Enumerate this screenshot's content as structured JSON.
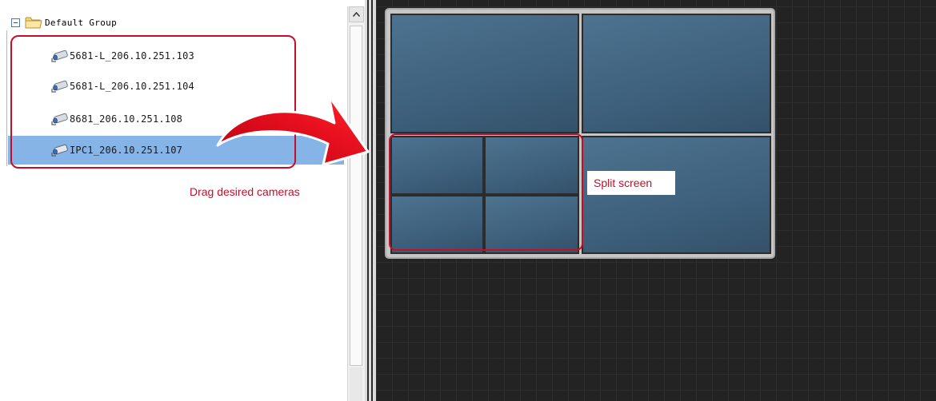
{
  "tree": {
    "root_label": "Default Group",
    "cameras": [
      {
        "label": "5681-L_206.10.251.103",
        "selected": false
      },
      {
        "label": "5681-L_206.10.251.104",
        "selected": false
      },
      {
        "label": "8681_206.10.251.108",
        "selected": false
      },
      {
        "label": "IPC1_206.10.251.107",
        "selected": true
      }
    ]
  },
  "annotations": {
    "drag_label": "Drag desired cameras",
    "split_label": "Split screen"
  },
  "icons": {
    "expander": "collapse-minus-icon",
    "folder": "folder-icon",
    "camera": "camera-icon",
    "scroll_up": "scroll-up-arrow-icon"
  },
  "colors": {
    "annotation_red": "#c40f2a",
    "selection_blue": "#86b4e6",
    "screen_blue": "#3f627e",
    "wall_dark": "#232323"
  }
}
